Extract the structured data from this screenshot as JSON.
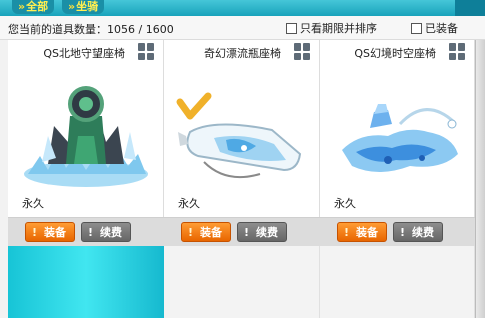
{
  "tabs": {
    "all_label": "全部",
    "mount_label": "坐骑"
  },
  "status": {
    "count_text": "您当前的道具数量：1056 / 1600",
    "filter_expiry_label": "只看期限并排序",
    "filter_equipped_label": "已装备"
  },
  "items": [
    {
      "name": "QS北地守望座椅",
      "duration": "永久",
      "equip_label": "装备",
      "renew_label": "续费"
    },
    {
      "name": "奇幻漂流瓶座椅",
      "duration": "永久",
      "equip_label": "装备",
      "renew_label": "续费"
    },
    {
      "name": "QS幻境时空座椅",
      "duration": "永久",
      "equip_label": "装备",
      "renew_label": "续费"
    }
  ],
  "icons": {
    "tab_arrow": "chevron-right-icon",
    "grid": "grid-view-icon",
    "checkmark": "checkmark-icon"
  },
  "colors": {
    "accent_teal": "#19a3bb",
    "equip_orange": "#ff8a1c",
    "renew_gray": "#777777",
    "tab_text_yellow": "#ffef50"
  }
}
